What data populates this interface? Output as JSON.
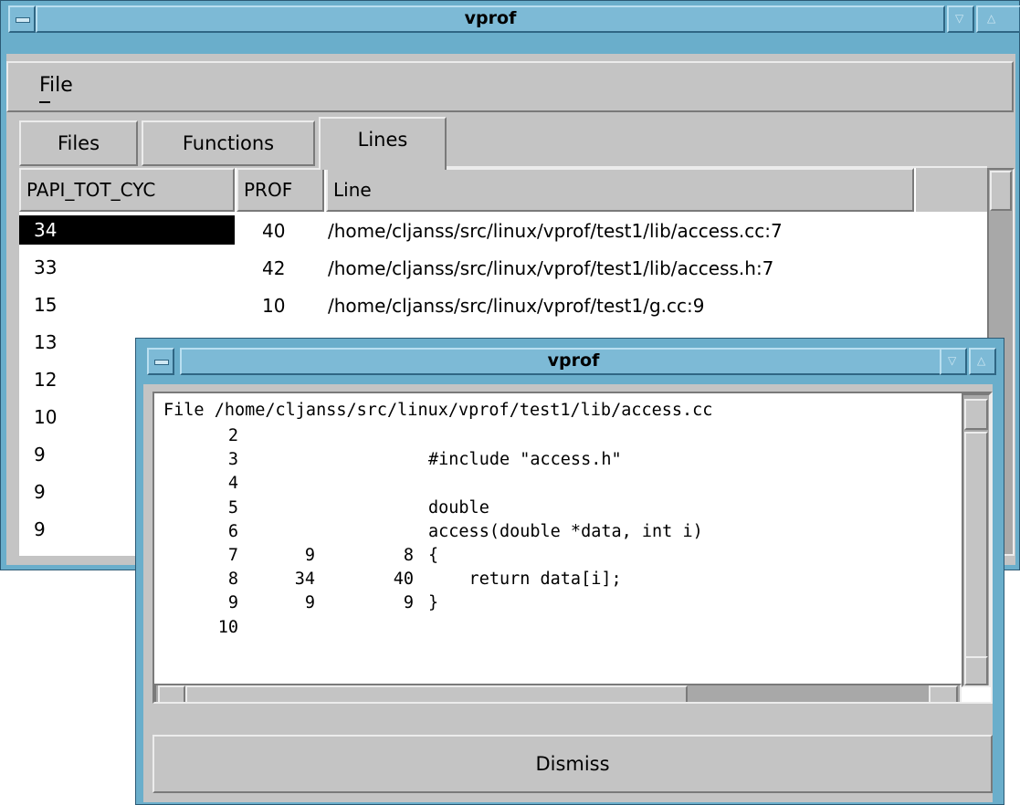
{
  "main_window": {
    "title": "vprof",
    "menu": {
      "file_label": "File"
    },
    "tabs": [
      {
        "label": "Files",
        "active": false
      },
      {
        "label": "Functions",
        "active": false
      },
      {
        "label": "Lines",
        "active": true
      }
    ],
    "columns": [
      "PAPI_TOT_CYC",
      "PROF",
      "Line"
    ],
    "rows": [
      {
        "cyc": "34",
        "prof": "40",
        "line": "/home/cljanss/src/linux/vprof/test1/lib/access.cc:7",
        "selected": true
      },
      {
        "cyc": "33",
        "prof": "42",
        "line": "/home/cljanss/src/linux/vprof/test1/lib/access.h:7"
      },
      {
        "cyc": "15",
        "prof": "10",
        "line": "/home/cljanss/src/linux/vprof/test1/g.cc:9"
      },
      {
        "cyc": "13",
        "prof": "",
        "line": ""
      },
      {
        "cyc": "12",
        "prof": "",
        "line": ""
      },
      {
        "cyc": "10",
        "prof": "",
        "line": ""
      },
      {
        "cyc": "9",
        "prof": "",
        "line": ""
      },
      {
        "cyc": "9",
        "prof": "",
        "line": ""
      },
      {
        "cyc": "9",
        "prof": "",
        "line": ""
      }
    ]
  },
  "source_window": {
    "title": "vprof",
    "header": "File /home/cljanss/src/linux/vprof/test1/lib/access.cc",
    "lines": [
      {
        "num": "2",
        "cyc": "",
        "prof": "",
        "code": ""
      },
      {
        "num": "3",
        "cyc": "",
        "prof": "",
        "code": "#include \"access.h\""
      },
      {
        "num": "4",
        "cyc": "",
        "prof": "",
        "code": ""
      },
      {
        "num": "5",
        "cyc": "",
        "prof": "",
        "code": "double"
      },
      {
        "num": "6",
        "cyc": "",
        "prof": "",
        "code": "access(double *data, int i)"
      },
      {
        "num": "7",
        "cyc": "9",
        "prof": "8",
        "code": "{"
      },
      {
        "num": "8",
        "cyc": "34",
        "prof": "40",
        "code": "    return data[i];"
      },
      {
        "num": "9",
        "cyc": "9",
        "prof": "9",
        "code": "}"
      },
      {
        "num": "10",
        "cyc": "",
        "prof": "",
        "code": ""
      }
    ],
    "dismiss_label": "Dismiss"
  },
  "colors": {
    "frame": "#6aaecb",
    "panel": "#c4c4c4",
    "selection": "#000000"
  }
}
